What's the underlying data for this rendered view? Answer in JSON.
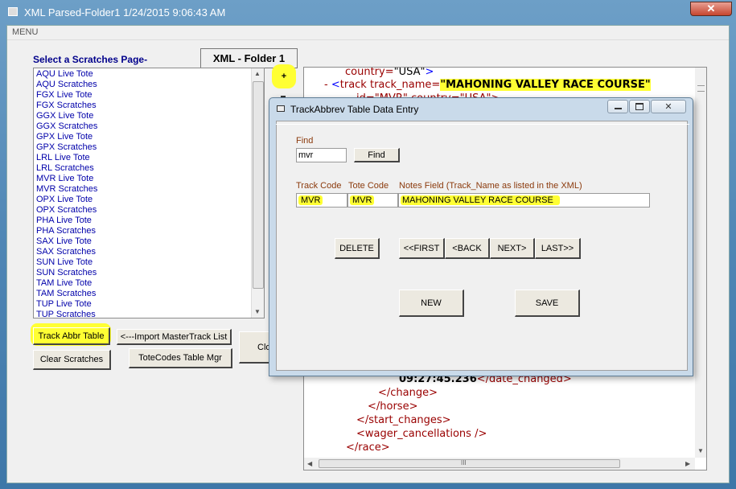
{
  "main_window": {
    "title": "XML Parsed-Folder1 1/24/2015 9:06:43 AM",
    "menu": "MENU"
  },
  "left_panel": {
    "select_label": "Select a Scratches Page-",
    "folder_button": "XML - Folder 1",
    "plus_button": "+",
    "list_items": [
      "AQU Live Tote",
      "AQU Scratches",
      "FGX Live Tote",
      "FGX Scratches",
      "GGX Live Tote",
      "GGX Scratches",
      "GPX Live Tote",
      "GPX Scratches",
      "LRL Live Tote",
      "LRL Scratches",
      "MVR Live Tote",
      "MVR Scratches",
      "OPX Live Tote",
      "OPX Scratches",
      "PHA Live Tote",
      "PHA Scratches",
      "SAX Live Tote",
      "SAX Scratches",
      "SUN Live Tote",
      "SUN Scratches",
      "TAM Live Tote",
      "TAM Scratches",
      "TUP Live Tote",
      "TUP Scratches"
    ],
    "track_abbr_button": "Track Abbr Table",
    "import_button": "<---Import MasterTrack List",
    "clear_button": "Clear Scratches",
    "totecodes_button": "ToteCodes Table Mgr",
    "close_button_partial": "Clo"
  },
  "xml_view": {
    "line1": {
      "attr": "country=",
      "val": "\"USA\"",
      "close": ">"
    },
    "line2": {
      "toggle": "-",
      "open": "<",
      "tag": "track",
      "attr": " track_name=",
      "val": "\"MAHONING VALLEY RACE COURSE\""
    },
    "line3_partial": "id=\"MVR\" country=\"USA\">",
    "bottom_lines": [
      {
        "indent": "date_val",
        "text": "09:27:45.236",
        "tag": "</date_changed>"
      },
      {
        "indent": 1,
        "text": "",
        "tag": "</change>"
      },
      {
        "indent": 2,
        "text": "",
        "tag": "</horse>"
      },
      {
        "indent": 3,
        "text": "",
        "tag": "</start_changes>"
      },
      {
        "indent": 3,
        "text": "",
        "tag": "<wager_cancellations />"
      },
      {
        "indent": 4,
        "text": "",
        "tag": "</race>"
      }
    ],
    "scroll_mark": "III"
  },
  "dialog": {
    "title": "TrackAbbrev Table Data Entry",
    "find_label": "Find",
    "find_value": "mvr",
    "find_button": "Find",
    "track_code_label": "Track Code",
    "tote_code_label": "Tote Code",
    "notes_label": "Notes Field (Track_Name as listed in the XML)",
    "track_code_value": "MVR",
    "tote_code_value": "MVR",
    "notes_value": "MAHONING VALLEY RACE COURSE",
    "delete_button": "DELETE",
    "first_button": "<<FIRST",
    "back_button": "<BACK",
    "next_button": "NEXT>",
    "last_button": "LAST>>",
    "new_button": "NEW",
    "save_button": "SAVE"
  },
  "colors": {
    "highlight": "#ffff33",
    "list_text": "#0000aa",
    "label_text": "#8b3a0c",
    "xml_tag": "#990000"
  }
}
